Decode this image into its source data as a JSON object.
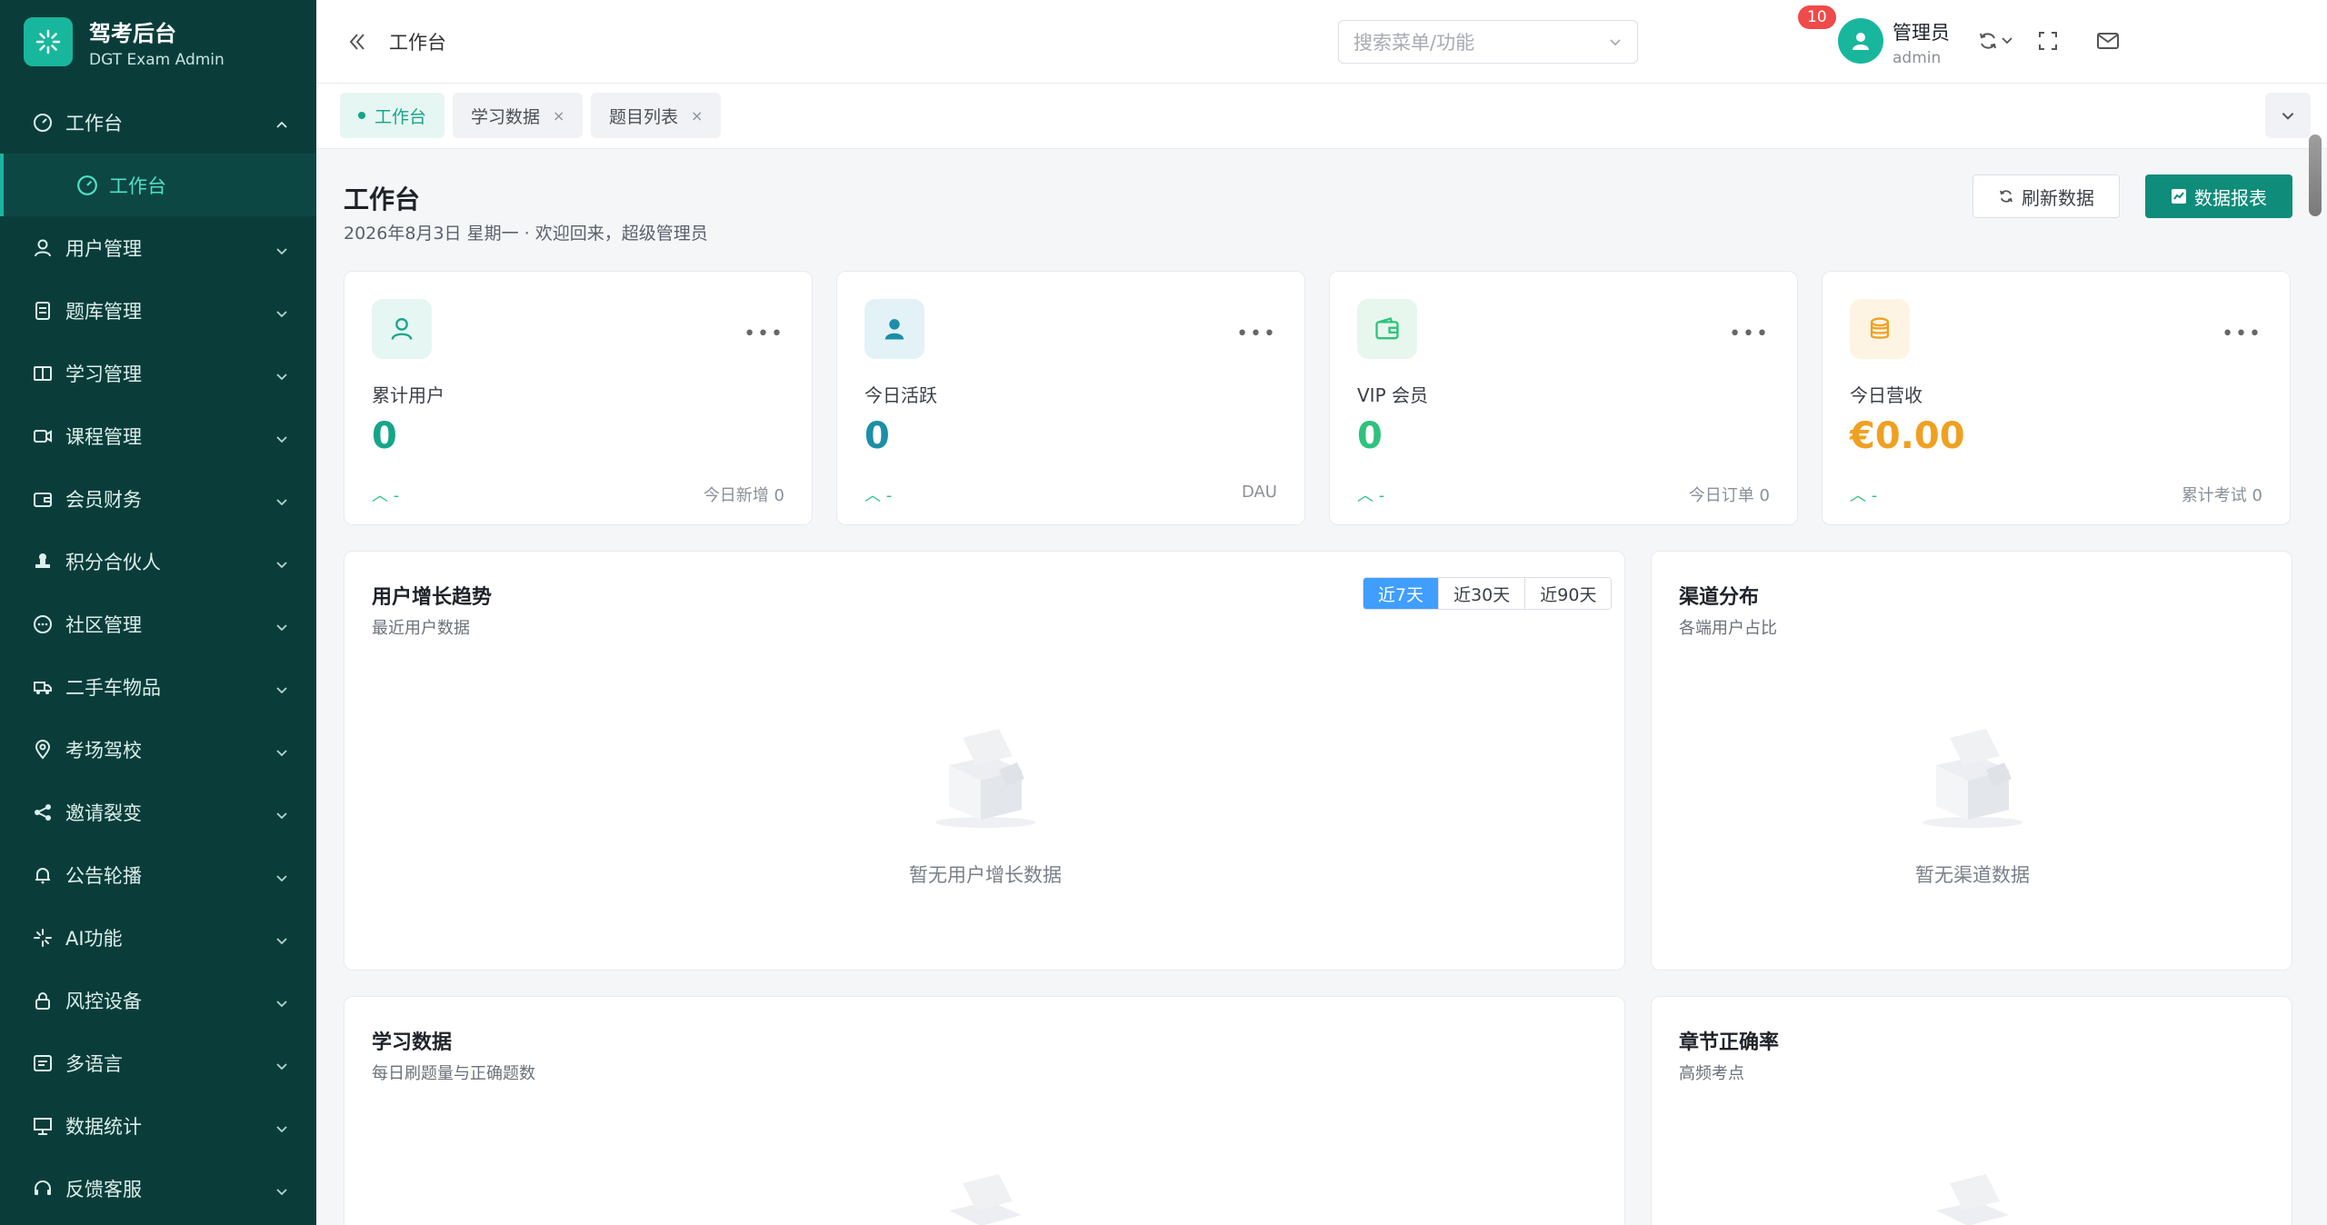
{
  "brand": {
    "title": "驾考后台",
    "subtitle": "DGT Exam Admin",
    "accent": "#18b79d",
    "sidebar_bg": "#0a3d3a"
  },
  "sidebar": {
    "workbench": {
      "label": "工作台",
      "icon": "dashboard-icon"
    },
    "workbench_sub": {
      "label": "工作台",
      "icon": "dashboard-icon"
    },
    "items": [
      {
        "label": "用户管理",
        "icon": "user-icon"
      },
      {
        "label": "题库管理",
        "icon": "document-icon"
      },
      {
        "label": "学习管理",
        "icon": "book-icon"
      },
      {
        "label": "课程管理",
        "icon": "video-icon"
      },
      {
        "label": "会员财务",
        "icon": "wallet-icon"
      },
      {
        "label": "积分合伙人",
        "icon": "stamp-icon"
      },
      {
        "label": "社区管理",
        "icon": "chat-icon"
      },
      {
        "label": "二手车物品",
        "icon": "truck-icon"
      },
      {
        "label": "考场驾校",
        "icon": "location-icon"
      },
      {
        "label": "邀请裂变",
        "icon": "share-icon"
      },
      {
        "label": "公告轮播",
        "icon": "bell-icon"
      },
      {
        "label": "AI功能",
        "icon": "sparkle-icon"
      },
      {
        "label": "风控设备",
        "icon": "lock-icon"
      },
      {
        "label": "多语言",
        "icon": "message-icon"
      },
      {
        "label": "数据统计",
        "icon": "chart-icon"
      },
      {
        "label": "反馈客服",
        "icon": "headset-icon"
      }
    ]
  },
  "topbar": {
    "breadcrumb": "工作台",
    "search_placeholder": "搜索菜单/功能",
    "notification_count": "10",
    "user_name": "管理员",
    "user_role": "admin"
  },
  "tabs": [
    {
      "label": "工作台",
      "active": true
    },
    {
      "label": "学习数据",
      "close": "×"
    },
    {
      "label": "题目列表",
      "close": "×"
    }
  ],
  "header": {
    "title": "工作台",
    "subtitle": "2026年8月3日 星期一 · 欢迎回来，超级管理员",
    "refresh_label": "刷新数据",
    "report_label": "数据报表"
  },
  "stats": [
    {
      "label": "累计用户",
      "value": "0",
      "trend": "-",
      "foot": "今日新增 0",
      "icon": "user-outline-icon",
      "color": "#16a589",
      "bg": "#e6f6f2"
    },
    {
      "label": "今日活跃",
      "value": "0",
      "trend": "-",
      "foot": "DAU",
      "icon": "user-solid-icon",
      "color": "#1b8ea8",
      "bg": "#e3f2f7"
    },
    {
      "label": "VIP 会员",
      "value": "0",
      "trend": "-",
      "foot": "今日订单 0",
      "icon": "wallet-icon",
      "color": "#2ec27e",
      "bg": "#e7f7ee"
    },
    {
      "label": "今日营收",
      "value": "€0.00",
      "trend": "-",
      "foot": "累计考试 0",
      "icon": "coins-icon",
      "color": "#f0a020",
      "bg": "#fdf4e3"
    }
  ],
  "panels": {
    "growth": {
      "title": "用户增长趋势",
      "subtitle": "最近用户数据",
      "ranges": [
        "近7天",
        "近30天",
        "近90天"
      ],
      "empty": "暂无用户增长数据"
    },
    "channel": {
      "title": "渠道分布",
      "subtitle": "各端用户占比",
      "empty": "暂无渠道数据"
    },
    "study": {
      "title": "学习数据",
      "subtitle": "每日刷题量与正确题数"
    },
    "chapter": {
      "title": "章节正确率",
      "subtitle": "高频考点"
    }
  }
}
